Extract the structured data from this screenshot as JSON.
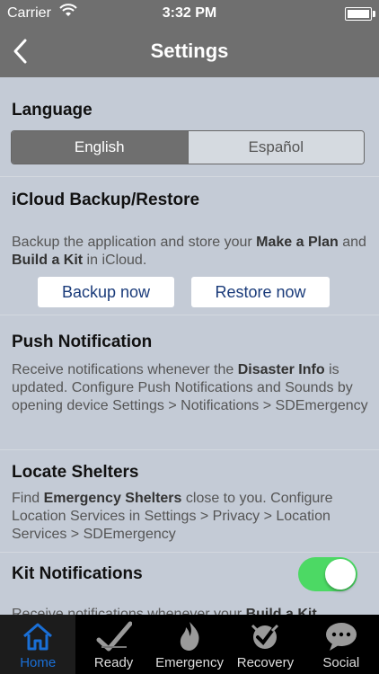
{
  "status_bar": {
    "carrier": "Carrier",
    "time": "3:32 PM"
  },
  "nav": {
    "title": "Settings"
  },
  "language": {
    "heading": "Language",
    "options": [
      "English",
      "Español"
    ],
    "selected": "English"
  },
  "icloud": {
    "heading": "iCloud Backup/Restore",
    "desc_1": "Backup the application and store your ",
    "desc_bold_1": "Make a Plan",
    "desc_2": " and ",
    "desc_bold_2": "Build a Kit",
    "desc_3": " in iCloud.",
    "backup_label": "Backup now",
    "restore_label": "Restore now"
  },
  "push": {
    "heading": "Push Notification",
    "desc_1": "Receive notifications whenever the ",
    "desc_bold": "Disaster Info",
    "desc_2": " is updated. Configure Push Notifications and Sounds by opening device Settings > Notifications > SDEmergency"
  },
  "shelters": {
    "heading": "Locate Shelters",
    "desc_1": "Find ",
    "desc_bold": "Emergency Shelters",
    "desc_2": " close to you. Configure Location Services in Settings > Privacy > Location Services > SDEmergency"
  },
  "kit": {
    "heading": "Kit Notifications",
    "enabled": true,
    "desc_1": "Receive notifications whenever your ",
    "desc_bold": "Build a Kit"
  },
  "tabs": [
    {
      "label": "Home",
      "icon": "home-icon",
      "active": true
    },
    {
      "label": "Ready",
      "icon": "checkmark-icon",
      "active": false
    },
    {
      "label": "Emergency",
      "icon": "fire-icon",
      "active": false
    },
    {
      "label": "Recovery",
      "icon": "recovery-icon",
      "active": false
    },
    {
      "label": "Social",
      "icon": "chat-bubble-icon",
      "active": false
    }
  ],
  "colors": {
    "toggle_on": "#4cd964",
    "tab_active": "#1a6fd6",
    "bar": "#6f6f6f",
    "button_text": "#1a3b7a"
  }
}
